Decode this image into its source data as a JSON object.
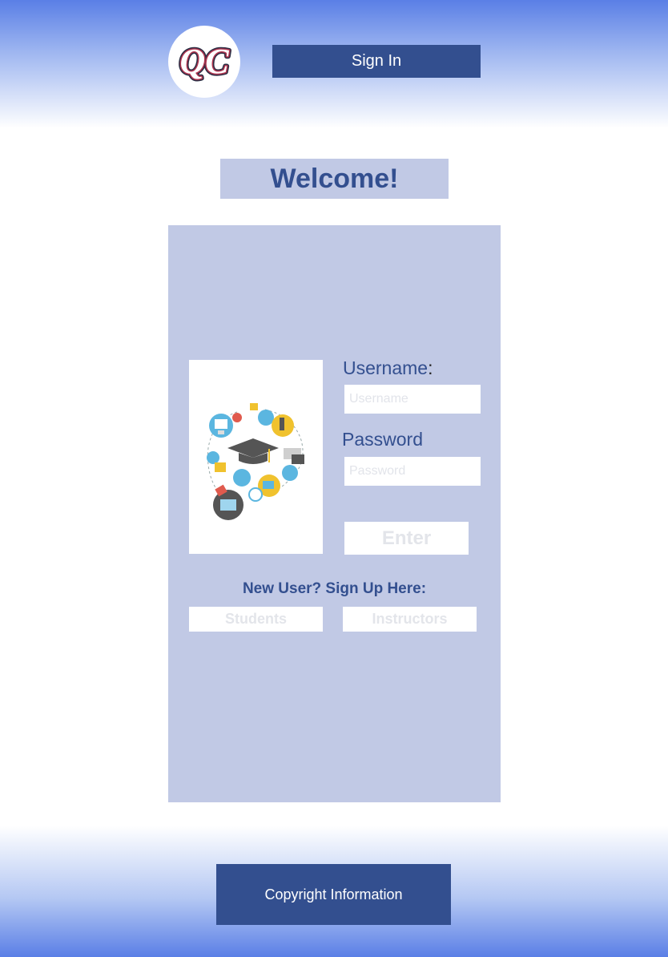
{
  "header": {
    "logo_text": "QC",
    "signin_label": "Sign In"
  },
  "welcome": "Welcome!",
  "login": {
    "username_label": "Username",
    "username_colon": ":",
    "username_placeholder": "Username",
    "password_label": "Password",
    "password_placeholder": "Password",
    "enter_label": "Enter"
  },
  "signup": {
    "prompt": "New User? Sign Up Here:",
    "students_label": "Students",
    "instructors_label": "Instructors"
  },
  "footer": {
    "copyright_label": "Copyright Information"
  },
  "colors": {
    "primary": "#334f8f",
    "panel": "#c1c9e5",
    "gradient": "#5a7fe6"
  }
}
